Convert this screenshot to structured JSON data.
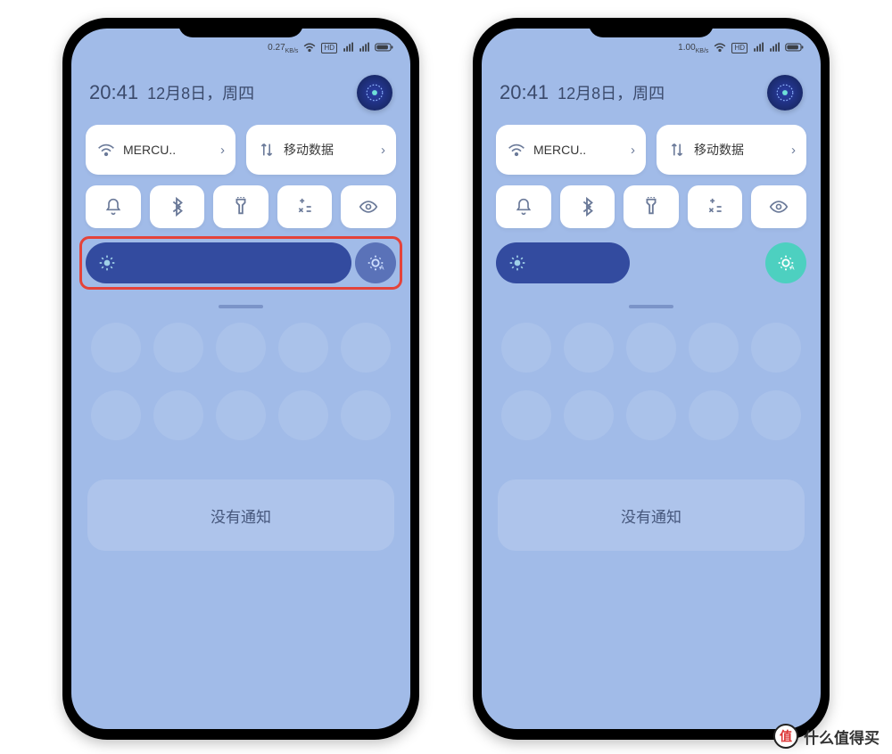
{
  "phone_left": {
    "status": {
      "speed": "0.27",
      "speed_unit": "KB/s"
    },
    "time": "20:41",
    "date": "12月8日，周四",
    "tiles": {
      "wifi_label": "MERCU..",
      "data_label": "移动数据"
    },
    "no_notif": "没有通知"
  },
  "phone_right": {
    "status": {
      "speed": "1.00",
      "speed_unit": "KB/s"
    },
    "time": "20:41",
    "date": "12月8日，周四",
    "tiles": {
      "wifi_label": "MERCU..",
      "data_label": "移动数据"
    },
    "no_notif": "没有通知"
  },
  "watermark": {
    "badge": "值",
    "text": "什么值得买"
  }
}
